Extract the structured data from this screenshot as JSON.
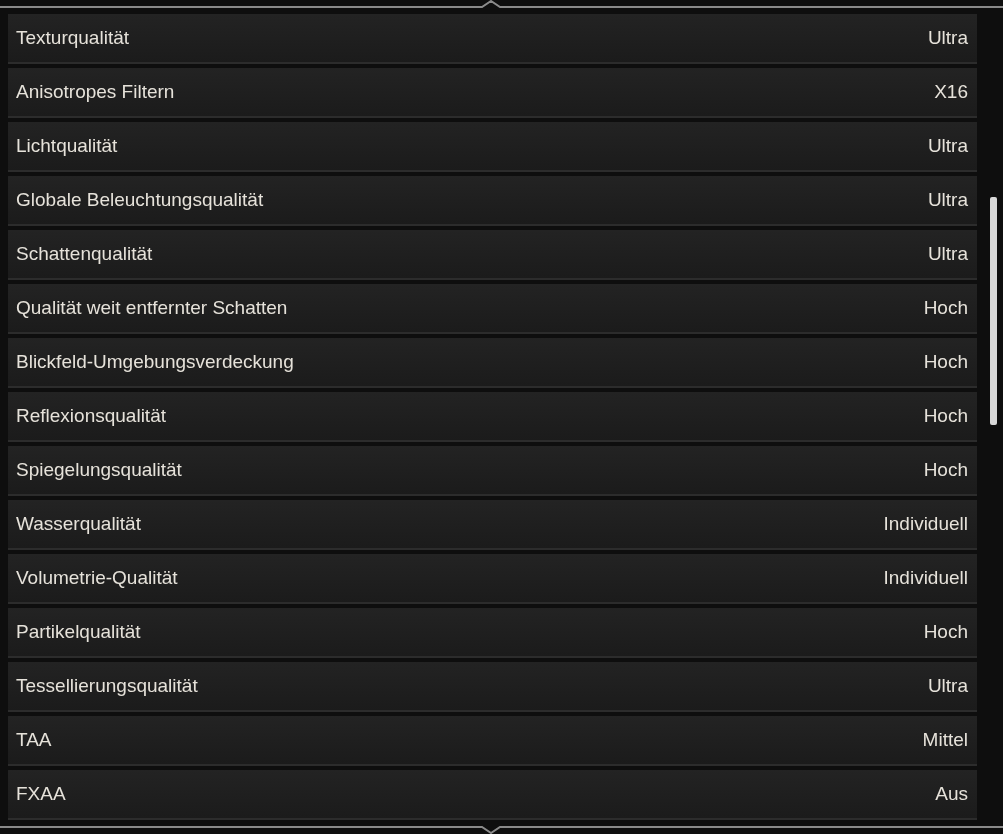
{
  "settings": [
    {
      "label": "Texturqualität",
      "value": "Ultra"
    },
    {
      "label": "Anisotropes Filtern",
      "value": "X16"
    },
    {
      "label": "Lichtqualität",
      "value": "Ultra"
    },
    {
      "label": "Globale Beleuchtungsqualität",
      "value": "Ultra"
    },
    {
      "label": "Schattenqualität",
      "value": "Ultra"
    },
    {
      "label": "Qualität weit entfernter Schatten",
      "value": "Hoch"
    },
    {
      "label": "Blickfeld-Umgebungsverdeckung",
      "value": "Hoch"
    },
    {
      "label": "Reflexionsqualität",
      "value": "Hoch"
    },
    {
      "label": "Spiegelungsqualität",
      "value": "Hoch"
    },
    {
      "label": "Wasserqualität",
      "value": "Individuell"
    },
    {
      "label": "Volumetrie-Qualität",
      "value": "Individuell"
    },
    {
      "label": "Partikelqualität",
      "value": "Hoch"
    },
    {
      "label": "Tessellierungsqualität",
      "value": "Ultra"
    },
    {
      "label": "TAA",
      "value": "Mittel"
    },
    {
      "label": "FXAA",
      "value": "Aus"
    }
  ]
}
